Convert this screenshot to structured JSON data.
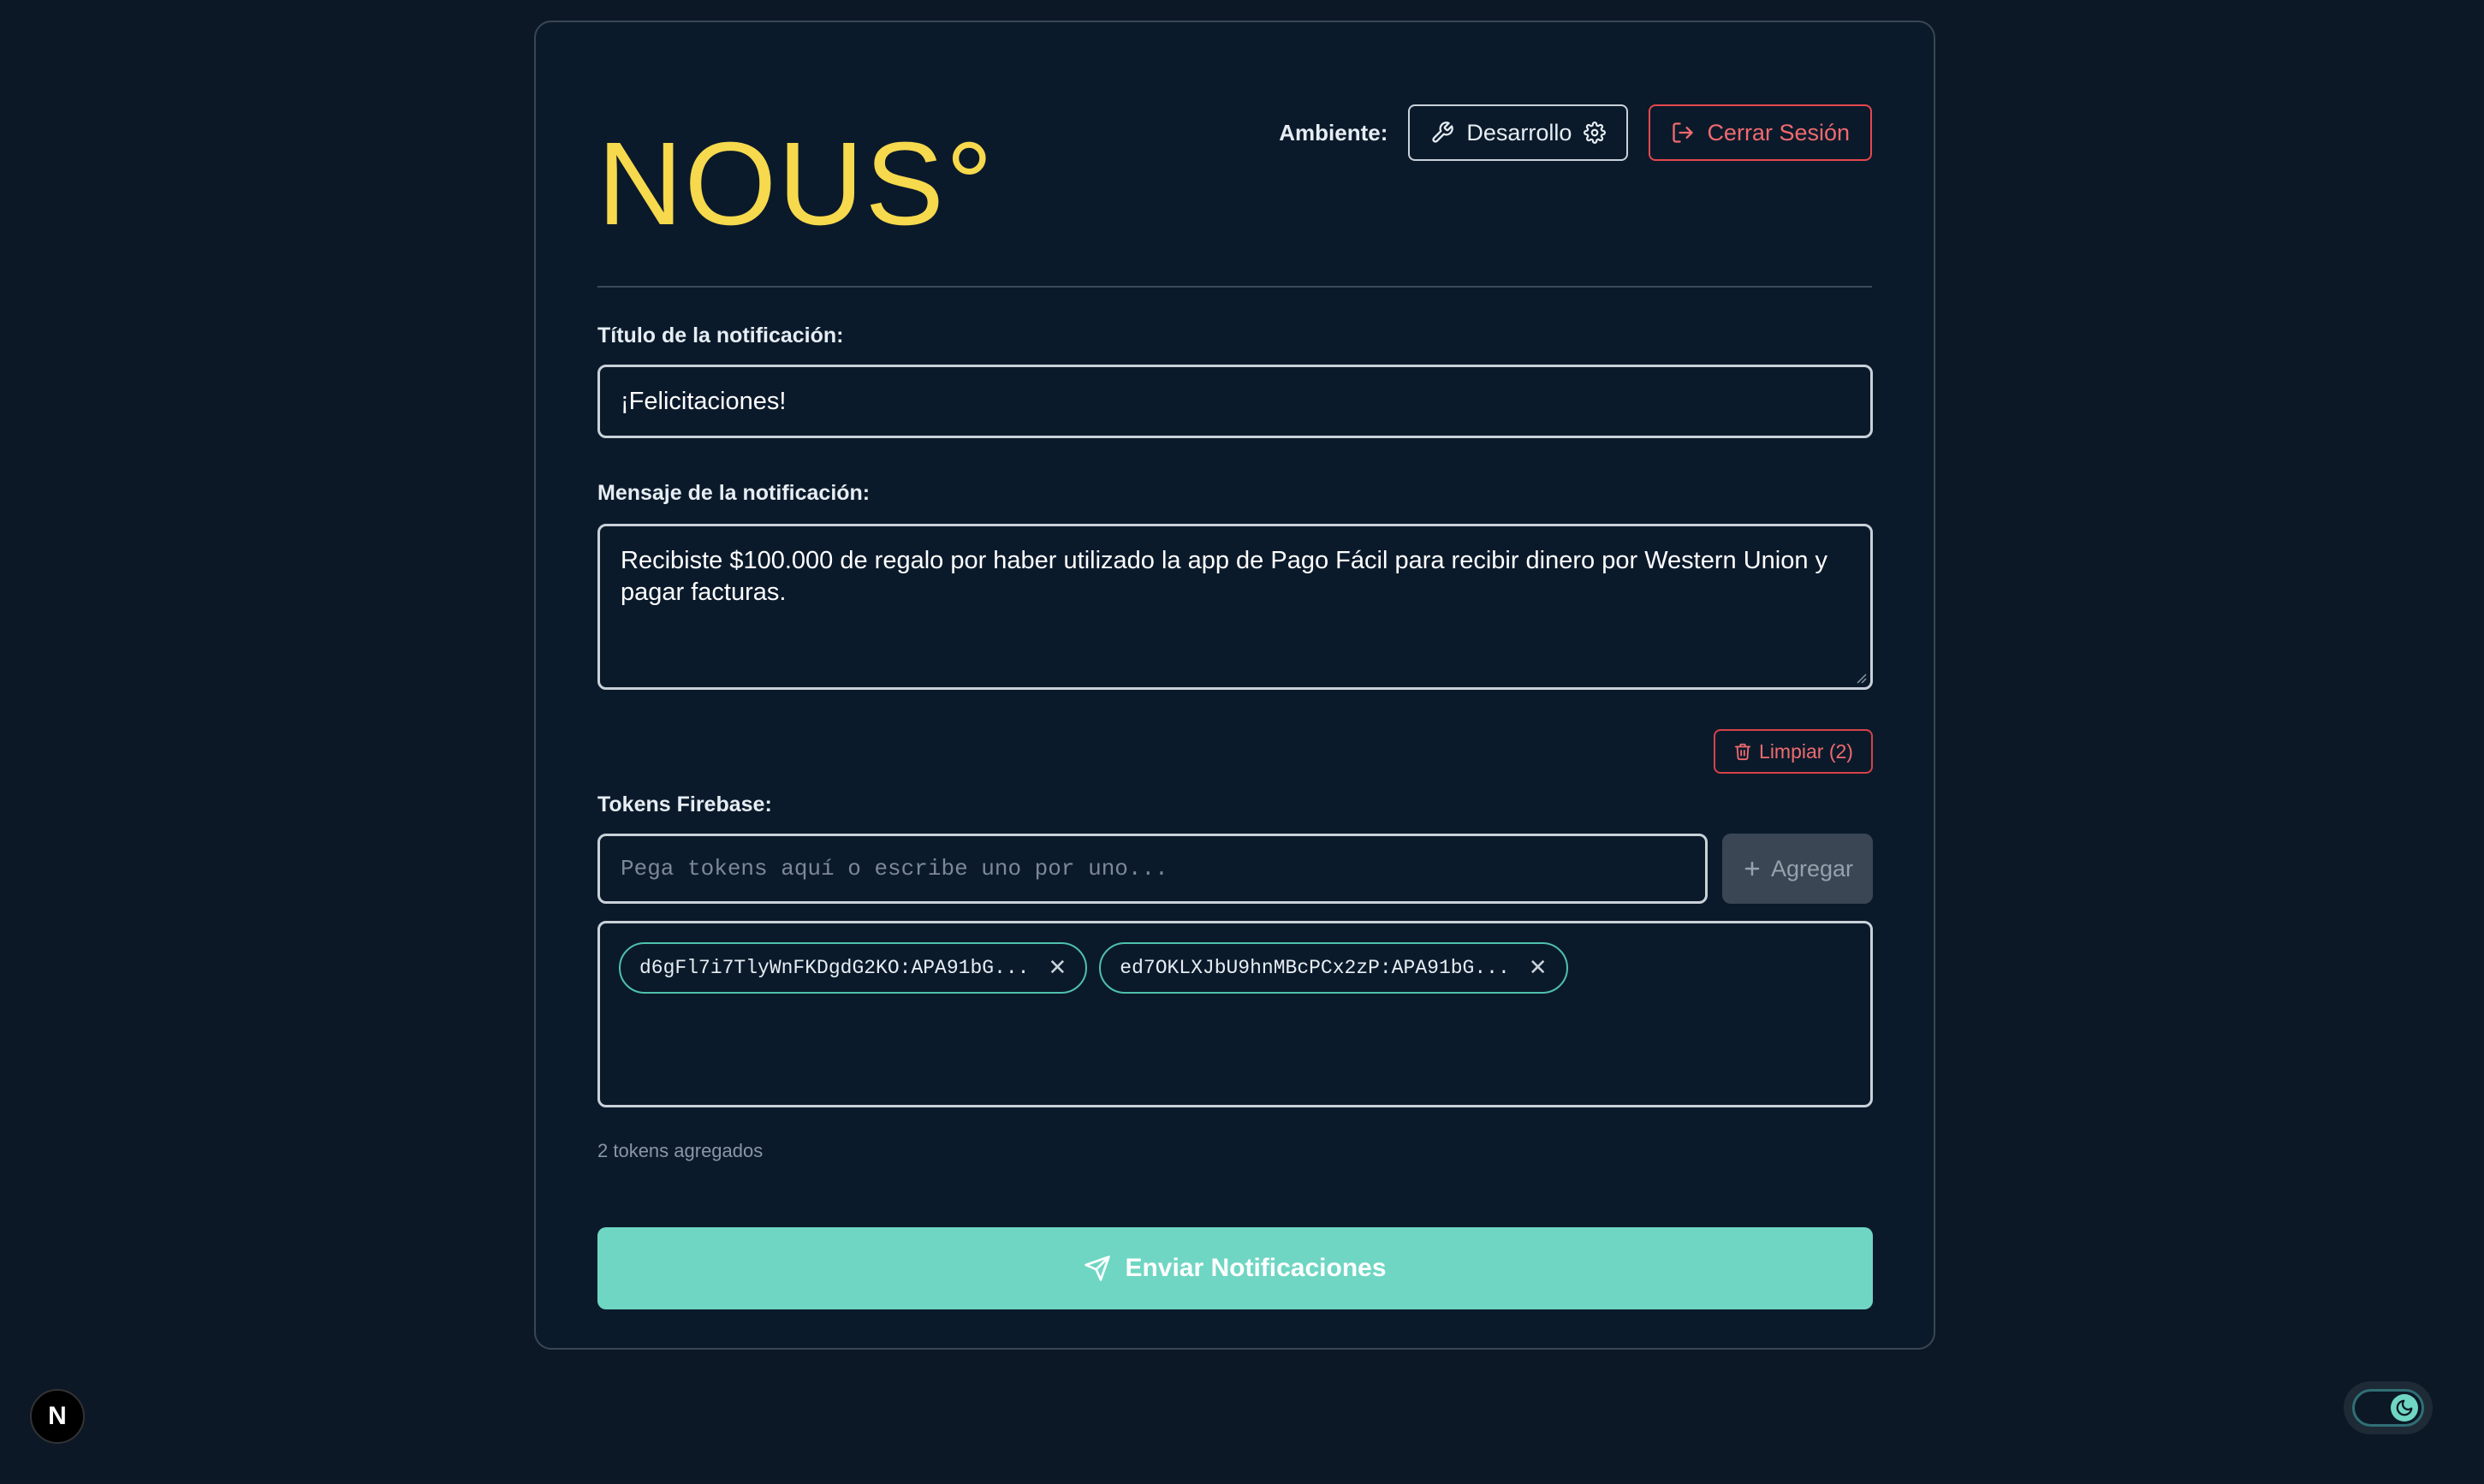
{
  "header": {
    "logo": "NOUS°",
    "environment_label": "Ambiente:",
    "environment_value": "Desarrollo",
    "logout_label": "Cerrar Sesión"
  },
  "form": {
    "title_label": "Título de la notificación:",
    "title_value": "¡Felicitaciones!",
    "message_label": "Mensaje de la notificación:",
    "message_value": "Recibiste $100.000 de regalo por haber utilizado la app de Pago Fácil para recibir dinero por Western Union y pagar facturas.",
    "clear_label": "Limpiar (2)",
    "tokens_label": "Tokens Firebase:",
    "token_placeholder": "Pega tokens aquí o escribe uno por uno...",
    "add_label": "Agregar",
    "tokens": [
      "d6gFl7i7TlyWnFKDgdG2KO:APA91bG...",
      "ed7OKLXJbU9hnMBcPCx2zP:APA91bG..."
    ],
    "token_count": "2 tokens agregados",
    "send_label": "Enviar Notificaciones"
  },
  "footer": {
    "framework_badge": "N"
  },
  "colors": {
    "background": "#0c1826",
    "logo": "#f6d94c",
    "accent": "#6fd6c3",
    "danger": "#e5484d"
  }
}
